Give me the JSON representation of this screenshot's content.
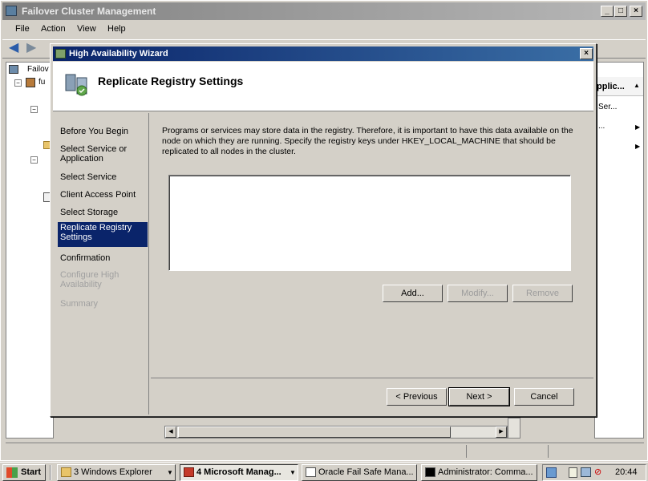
{
  "window": {
    "title": "Failover Cluster Management"
  },
  "menu": [
    "File",
    "Action",
    "View",
    "Help"
  ],
  "tree": {
    "root_label": "Failov",
    "node_label": "fu"
  },
  "actions": {
    "header": "pplic...",
    "item1": "Ser...",
    "item2": "..."
  },
  "wizard": {
    "title": "High Availability Wizard",
    "heading": "Replicate Registry Settings",
    "nav": [
      {
        "label": "Before You Begin",
        "state": "normal"
      },
      {
        "label": "Select Service or Application",
        "state": "normal"
      },
      {
        "label": "Select Service",
        "state": "normal"
      },
      {
        "label": "Client Access Point",
        "state": "normal"
      },
      {
        "label": "Select Storage",
        "state": "normal"
      },
      {
        "label": "Replicate Registry Settings",
        "state": "selected"
      },
      {
        "label": "Confirmation",
        "state": "normal"
      },
      {
        "label": "Configure High Availability",
        "state": "disabled"
      },
      {
        "label": "Summary",
        "state": "disabled"
      }
    ],
    "description": "Programs or services may store data in the registry.  Therefore, it is important to have this data available on the node on which they are running.  Specify the registry keys under HKEY_LOCAL_MACHINE that should be replicated to all nodes in the cluster.",
    "buttons": {
      "add": "Add...",
      "modify": "Modify...",
      "remove": "Remove"
    },
    "footer": {
      "previous": "< Previous",
      "next": "Next >",
      "cancel": "Cancel"
    }
  },
  "taskbar": {
    "start": "Start",
    "tasks": [
      "3 Windows Explorer",
      "4 Microsoft Manag...",
      "Oracle Fail Safe Mana...",
      "Administrator: Comma..."
    ],
    "clock": "20:44"
  }
}
